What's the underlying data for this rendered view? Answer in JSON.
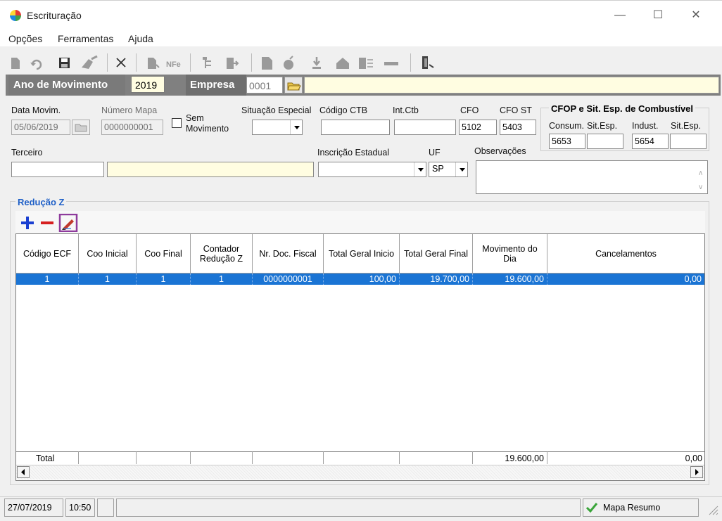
{
  "window": {
    "title": "Escrituração",
    "controls": {
      "minimize": "—",
      "maximize": "☐",
      "close": "✕"
    }
  },
  "menu": [
    "Opções",
    "Ferramentas",
    "Ajuda"
  ],
  "header": {
    "ano_label": "Ano de Movimento",
    "ano_value": "2019",
    "empresa_label": "Empresa",
    "empresa_value": "0001"
  },
  "form": {
    "data_movim_label": "Data Movim.",
    "data_movim_value": "05/06/2019",
    "numero_mapa_label": "Número Mapa",
    "numero_mapa_value": "0000000001",
    "sem_movimento_label_1": "Sem",
    "sem_movimento_label_2": "Movimento",
    "situacao_especial_label": "Situação Especial",
    "codigo_ctb_label": "Código CTB",
    "int_ctb_label": "Int.Ctb",
    "cfo_label": "CFO",
    "cfo_value": "5102",
    "cfo_st_label": "CFO ST",
    "cfo_st_value": "5403",
    "terceiro_label": "Terceiro",
    "inscricao_label": "Inscrição Estadual",
    "uf_label": "UF",
    "uf_value": "SP",
    "observacoes_label": "Observações"
  },
  "cfop_group": {
    "title": "CFOP e Sit. Esp. de Combustível",
    "consum_label": "Consum.",
    "sit_esp_label_1": "Sit.Esp.",
    "indust_label": "Indust.",
    "sit_esp_label_2": "Sit.Esp.",
    "consum_value": "5653",
    "indust_value": "5654"
  },
  "reducao_z": {
    "title": "Redução Z",
    "columns": [
      {
        "label": "Código ECF"
      },
      {
        "label": "Coo Inicial"
      },
      {
        "label": "Coo Final"
      },
      {
        "label": "Contador Redução Z"
      },
      {
        "label": "Nr. Doc. Fiscal"
      },
      {
        "label": "Total Geral Inicio"
      },
      {
        "label": "Total Geral Final"
      },
      {
        "label": "Movimento do Dia"
      },
      {
        "label": "Cancelamentos"
      }
    ],
    "rows": [
      [
        "1",
        "1",
        "1",
        "1",
        "0000000001",
        "100,00",
        "19.700,00",
        "19.600,00",
        "0,00"
      ]
    ],
    "footer": {
      "label": "Total",
      "movimento_do_dia": "19.600,00",
      "cancelamentos": "0,00"
    }
  },
  "statusbar": {
    "date": "27/07/2019",
    "time": "10:50",
    "module": "Mapa Resumo"
  },
  "colors": {
    "selection": "#1a74d4",
    "header_strip": "#808080",
    "accent_blue": "#1e5fc7",
    "add_icon": "#1a3fd1",
    "remove_icon": "#d61f1f",
    "edit_highlight": "#8e3b9c"
  }
}
